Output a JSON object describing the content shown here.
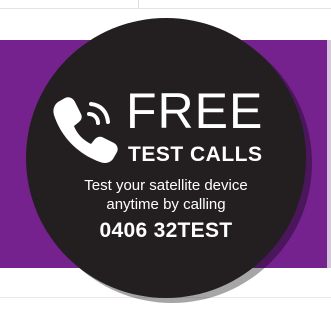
{
  "promo": {
    "headline": "FREE",
    "subheadline": "TEST CALLS",
    "description_line1": "Test your satellite device",
    "description_line2": "anytime by calling",
    "phone_number": "0406 32TEST",
    "icon": "phone-ringing-icon"
  },
  "colors": {
    "band": "#75228e",
    "badge": "#231f20",
    "text": "#ffffff"
  }
}
